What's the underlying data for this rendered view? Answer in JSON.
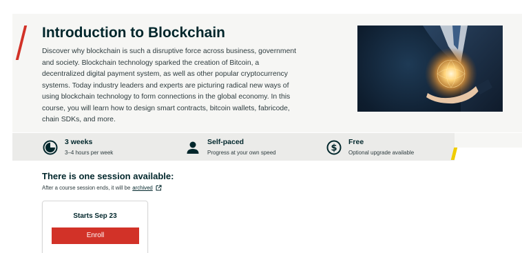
{
  "course": {
    "title": "Introduction to Blockchain",
    "description": "Discover why blockchain is such a disruptive force across business, government and society. Blockchain technology sparked the creation of Bitcoin, a decentralized digital payment system, as well as other popular cryptocurrency systems. Today industry leaders and experts are picturing radical new ways of using blockchain technology to form connections in the global economy. In this course, you will learn how to design smart contracts, bitcoin wallets, fabricode, chain SDKs, and more."
  },
  "stats": [
    {
      "icon": "clock-icon",
      "title": "3 weeks",
      "subtitle": "3–4 hours per week"
    },
    {
      "icon": "person-icon",
      "title": "Self-paced",
      "subtitle": "Progress at your own speed"
    },
    {
      "icon": "dollar-icon",
      "title": "Free",
      "subtitle": "Optional upgrade available"
    }
  ],
  "sessions": {
    "heading": "There is one session available:",
    "note_prefix": "After a course session ends, it will be",
    "note_link": "archived",
    "card": {
      "starts": "Starts Sep 23",
      "enroll_label": "Enroll"
    }
  },
  "colors": {
    "primary_text": "#00262b",
    "accent_red": "#d23228",
    "accent_yellow": "#f0cc00",
    "hero_background": "#f6f6f4",
    "stats_background": "#ebebe9"
  }
}
